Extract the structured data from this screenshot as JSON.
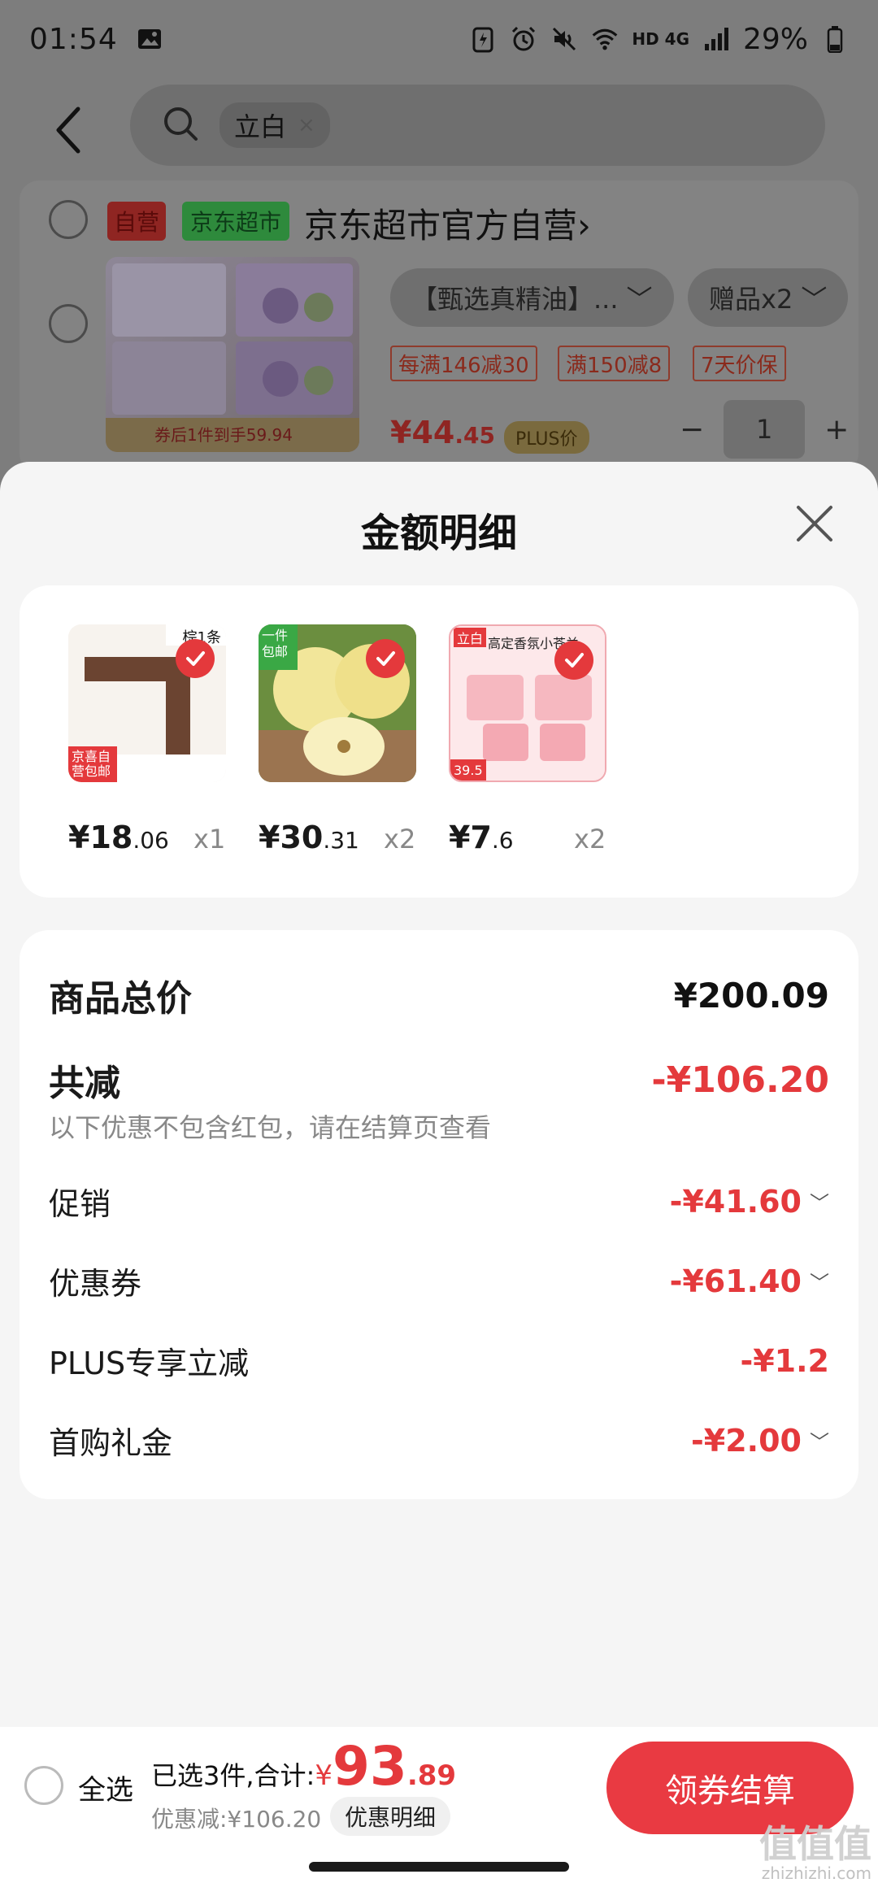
{
  "status_bar": {
    "time": "01:54",
    "network": "HD 4G",
    "battery": "29%"
  },
  "search": {
    "chip_label": "立白",
    "chip_clear": "×"
  },
  "background_cart": {
    "tag_self": "自营",
    "tag_market": "京东超市",
    "store_name": "京东超市官方自营",
    "store_chevron": "›",
    "product_banner": "券后1件到手59.94",
    "spec_label": "【甄选真精油】...",
    "gift_label": "赠品x2",
    "promos": [
      "每满146减30",
      "满150减8",
      "7天价保"
    ],
    "price_int": "¥44",
    "price_dec": ".45",
    "plus_tag": "PLUS价",
    "qty_minus": "−",
    "qty_value": "1",
    "qty_plus": "+"
  },
  "sheet": {
    "title": "金额明细",
    "items": [
      {
        "price_int": "¥18",
        "price_dec": ".06",
        "qty": "x1",
        "tag": "棕1条",
        "corner": "京喜自营包邮"
      },
      {
        "price_int": "¥30",
        "price_dec": ".31",
        "qty": "x2",
        "tag": "一件包邮"
      },
      {
        "price_int": "¥7",
        "price_dec": ".6",
        "qty": "x2",
        "tag": "立白",
        "header": "高定香氛小苍兰",
        "badge": "39.5"
      }
    ],
    "summary": {
      "total_label": "商品总价",
      "total_value": "¥200.09",
      "discount_label": "共减",
      "discount_value": "-¥106.20",
      "note": "以下优惠不包含红包，请在结算页查看",
      "rows": [
        {
          "label": "促销",
          "value": "-¥41.60",
          "chevron": "﹀"
        },
        {
          "label": "优惠券",
          "value": "-¥61.40",
          "chevron": "﹀"
        },
        {
          "label": "PLUS专享立减",
          "value": "-¥1.2",
          "chevron": ""
        },
        {
          "label": "首购礼金",
          "value": "-¥2.00",
          "chevron": "﹀"
        }
      ]
    }
  },
  "bottom_bar": {
    "select_all": "全选",
    "selected_prefix": "已选3件,合计:",
    "yen": "¥",
    "total_int": "93",
    "total_dec": ".89",
    "discount_text": "优惠减:¥106.20",
    "detail_button": "优惠明细",
    "checkout_button": "领券结算"
  },
  "watermark": {
    "text": "值值值",
    "sub": "zhizhizhi.com"
  },
  "colors": {
    "accent_red": "#e4393c",
    "checkout_red": "#e93a42"
  }
}
